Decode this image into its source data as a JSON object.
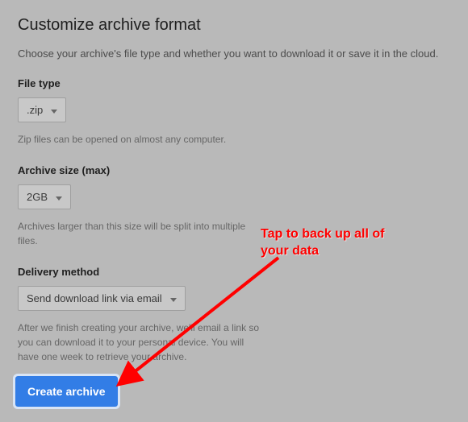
{
  "title": "Customize archive format",
  "subtitle": "Choose your archive's file type and whether you want to download it or save it in the cloud.",
  "file_type": {
    "label": "File type",
    "value": ".zip",
    "helper": "Zip files can be opened on almost any computer."
  },
  "archive_size": {
    "label": "Archive size (max)",
    "value": "2GB",
    "helper": "Archives larger than this size will be split into multiple files."
  },
  "delivery": {
    "label": "Delivery method",
    "value": "Send download link via email",
    "helper": "After we finish creating your archive, we'll email a link so you can download it to your personal device. You will have one week to retrieve your archive."
  },
  "create_button": "Create archive",
  "annotation": "Tap to back up all of\nyour data"
}
